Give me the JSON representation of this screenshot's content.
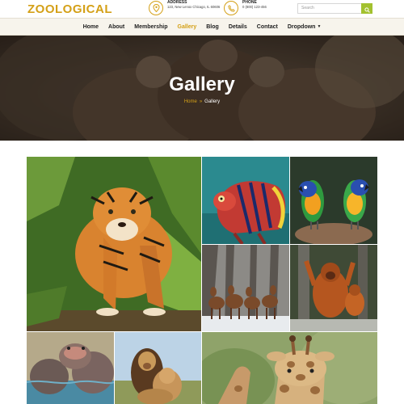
{
  "brand": {
    "logo": "ZOOLOGICAL",
    "accent": "#d4a017",
    "search_button_color": "#a3c12f"
  },
  "topbar": {
    "address": {
      "icon": "map-pin-icon",
      "label": "ADDRESS",
      "value": "123, New Lenox Chicago, IL 60606"
    },
    "phone": {
      "icon": "phone-icon",
      "label": "PHONE",
      "value": "0 (800) 123-456"
    },
    "search": {
      "placeholder": "Search",
      "icon": "search-icon"
    }
  },
  "nav": {
    "items": [
      {
        "label": "Home"
      },
      {
        "label": "About"
      },
      {
        "label": "Membership"
      },
      {
        "label": "Gallery",
        "active": true
      },
      {
        "label": "Blog"
      },
      {
        "label": "Details"
      },
      {
        "label": "Contact"
      },
      {
        "label": "Dropdown",
        "icon": "caret-down-icon"
      }
    ]
  },
  "hero": {
    "title": "Gallery",
    "breadcrumb": {
      "home": "Home",
      "separator": "»",
      "current": "Gallery"
    }
  },
  "gallery": {
    "images": [
      {
        "name": "tiger"
      },
      {
        "name": "chameleon"
      },
      {
        "name": "parrots"
      },
      {
        "name": "deer"
      },
      {
        "name": "orangutans"
      },
      {
        "name": "hippos"
      },
      {
        "name": "lions"
      },
      {
        "name": "giraffe"
      }
    ]
  }
}
